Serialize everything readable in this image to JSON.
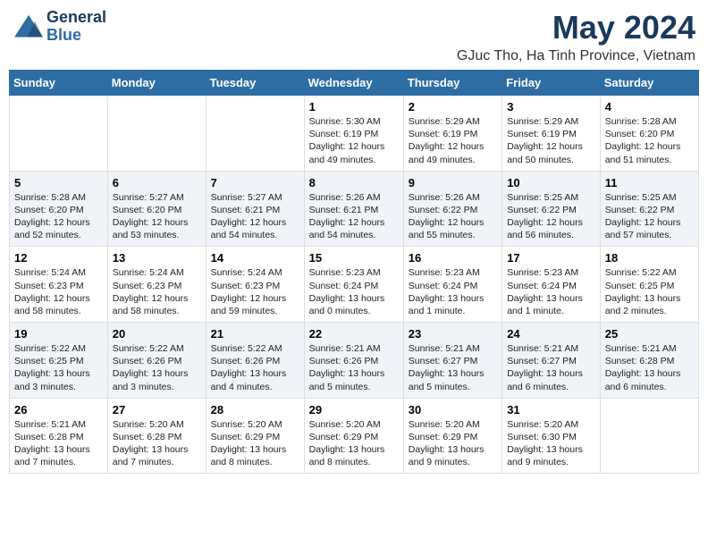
{
  "logo": {
    "line1": "General",
    "line2": "Blue"
  },
  "title": "May 2024",
  "subtitle": "GJuc Tho, Ha Tinh Province, Vietnam",
  "weekdays": [
    "Sunday",
    "Monday",
    "Tuesday",
    "Wednesday",
    "Thursday",
    "Friday",
    "Saturday"
  ],
  "weeks": [
    [
      {
        "day": "",
        "info": ""
      },
      {
        "day": "",
        "info": ""
      },
      {
        "day": "",
        "info": ""
      },
      {
        "day": "1",
        "info": "Sunrise: 5:30 AM\nSunset: 6:19 PM\nDaylight: 12 hours\nand 49 minutes."
      },
      {
        "day": "2",
        "info": "Sunrise: 5:29 AM\nSunset: 6:19 PM\nDaylight: 12 hours\nand 49 minutes."
      },
      {
        "day": "3",
        "info": "Sunrise: 5:29 AM\nSunset: 6:19 PM\nDaylight: 12 hours\nand 50 minutes."
      },
      {
        "day": "4",
        "info": "Sunrise: 5:28 AM\nSunset: 6:20 PM\nDaylight: 12 hours\nand 51 minutes."
      }
    ],
    [
      {
        "day": "5",
        "info": "Sunrise: 5:28 AM\nSunset: 6:20 PM\nDaylight: 12 hours\nand 52 minutes."
      },
      {
        "day": "6",
        "info": "Sunrise: 5:27 AM\nSunset: 6:20 PM\nDaylight: 12 hours\nand 53 minutes."
      },
      {
        "day": "7",
        "info": "Sunrise: 5:27 AM\nSunset: 6:21 PM\nDaylight: 12 hours\nand 54 minutes."
      },
      {
        "day": "8",
        "info": "Sunrise: 5:26 AM\nSunset: 6:21 PM\nDaylight: 12 hours\nand 54 minutes."
      },
      {
        "day": "9",
        "info": "Sunrise: 5:26 AM\nSunset: 6:22 PM\nDaylight: 12 hours\nand 55 minutes."
      },
      {
        "day": "10",
        "info": "Sunrise: 5:25 AM\nSunset: 6:22 PM\nDaylight: 12 hours\nand 56 minutes."
      },
      {
        "day": "11",
        "info": "Sunrise: 5:25 AM\nSunset: 6:22 PM\nDaylight: 12 hours\nand 57 minutes."
      }
    ],
    [
      {
        "day": "12",
        "info": "Sunrise: 5:24 AM\nSunset: 6:23 PM\nDaylight: 12 hours\nand 58 minutes."
      },
      {
        "day": "13",
        "info": "Sunrise: 5:24 AM\nSunset: 6:23 PM\nDaylight: 12 hours\nand 58 minutes."
      },
      {
        "day": "14",
        "info": "Sunrise: 5:24 AM\nSunset: 6:23 PM\nDaylight: 12 hours\nand 59 minutes."
      },
      {
        "day": "15",
        "info": "Sunrise: 5:23 AM\nSunset: 6:24 PM\nDaylight: 13 hours\nand 0 minutes."
      },
      {
        "day": "16",
        "info": "Sunrise: 5:23 AM\nSunset: 6:24 PM\nDaylight: 13 hours\nand 1 minute."
      },
      {
        "day": "17",
        "info": "Sunrise: 5:23 AM\nSunset: 6:24 PM\nDaylight: 13 hours\nand 1 minute."
      },
      {
        "day": "18",
        "info": "Sunrise: 5:22 AM\nSunset: 6:25 PM\nDaylight: 13 hours\nand 2 minutes."
      }
    ],
    [
      {
        "day": "19",
        "info": "Sunrise: 5:22 AM\nSunset: 6:25 PM\nDaylight: 13 hours\nand 3 minutes."
      },
      {
        "day": "20",
        "info": "Sunrise: 5:22 AM\nSunset: 6:26 PM\nDaylight: 13 hours\nand 3 minutes."
      },
      {
        "day": "21",
        "info": "Sunrise: 5:22 AM\nSunset: 6:26 PM\nDaylight: 13 hours\nand 4 minutes."
      },
      {
        "day": "22",
        "info": "Sunrise: 5:21 AM\nSunset: 6:26 PM\nDaylight: 13 hours\nand 5 minutes."
      },
      {
        "day": "23",
        "info": "Sunrise: 5:21 AM\nSunset: 6:27 PM\nDaylight: 13 hours\nand 5 minutes."
      },
      {
        "day": "24",
        "info": "Sunrise: 5:21 AM\nSunset: 6:27 PM\nDaylight: 13 hours\nand 6 minutes."
      },
      {
        "day": "25",
        "info": "Sunrise: 5:21 AM\nSunset: 6:28 PM\nDaylight: 13 hours\nand 6 minutes."
      }
    ],
    [
      {
        "day": "26",
        "info": "Sunrise: 5:21 AM\nSunset: 6:28 PM\nDaylight: 13 hours\nand 7 minutes."
      },
      {
        "day": "27",
        "info": "Sunrise: 5:20 AM\nSunset: 6:28 PM\nDaylight: 13 hours\nand 7 minutes."
      },
      {
        "day": "28",
        "info": "Sunrise: 5:20 AM\nSunset: 6:29 PM\nDaylight: 13 hours\nand 8 minutes."
      },
      {
        "day": "29",
        "info": "Sunrise: 5:20 AM\nSunset: 6:29 PM\nDaylight: 13 hours\nand 8 minutes."
      },
      {
        "day": "30",
        "info": "Sunrise: 5:20 AM\nSunset: 6:29 PM\nDaylight: 13 hours\nand 9 minutes."
      },
      {
        "day": "31",
        "info": "Sunrise: 5:20 AM\nSunset: 6:30 PM\nDaylight: 13 hours\nand 9 minutes."
      },
      {
        "day": "",
        "info": ""
      }
    ]
  ]
}
